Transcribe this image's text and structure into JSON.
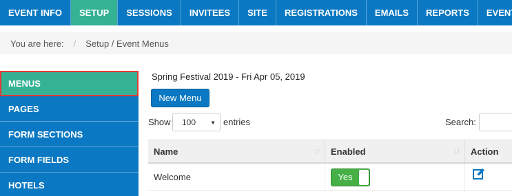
{
  "nav": {
    "tabs": [
      {
        "label": "EVENT INFO",
        "active": false
      },
      {
        "label": "SETUP",
        "active": true
      },
      {
        "label": "SESSIONS",
        "active": false
      },
      {
        "label": "INVITEES",
        "active": false
      },
      {
        "label": "SITE",
        "active": false
      },
      {
        "label": "REGISTRATIONS",
        "active": false
      },
      {
        "label": "EMAILS",
        "active": false
      },
      {
        "label": "REPORTS",
        "active": false
      },
      {
        "label": "EVENTS",
        "active": false
      }
    ]
  },
  "breadcrumb": {
    "prefix": "You are here:",
    "separator": "/",
    "path": "Setup / Event Menus"
  },
  "sidebar": {
    "items": [
      {
        "label": "MENUS",
        "active": true
      },
      {
        "label": "PAGES",
        "active": false
      },
      {
        "label": "FORM SECTIONS",
        "active": false
      },
      {
        "label": "FORM FIELDS",
        "active": false
      },
      {
        "label": "HOTELS",
        "active": false
      }
    ]
  },
  "main": {
    "event_title": "Spring Festival 2019 - Fri Apr 05, 2019",
    "new_menu_label": "New Menu",
    "show_label": "Show",
    "entries_value": "100",
    "entries_label": "entries",
    "search_label": "Search:"
  },
  "table": {
    "columns": [
      "Name",
      "Enabled",
      "Action"
    ],
    "rows": [
      {
        "name": "Welcome",
        "enabled_label": "Yes",
        "action_icon": "edit-icon"
      }
    ]
  },
  "colors": {
    "nav_blue": "#0a78c2",
    "active_green": "#35b294",
    "toggle_green": "#46b046",
    "highlight_red": "#e53935"
  }
}
